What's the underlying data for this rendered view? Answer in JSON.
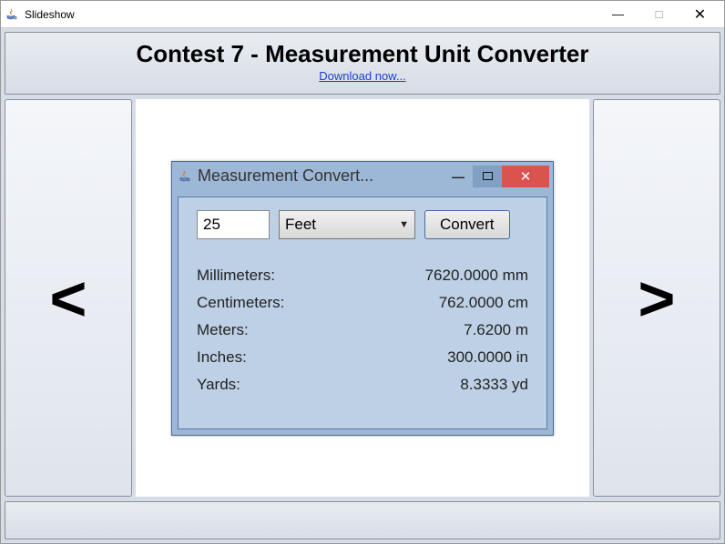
{
  "outer_window": {
    "title": "Slideshow",
    "minimize": "—",
    "maximize": "□",
    "close": "✕"
  },
  "header": {
    "title": "Contest 7 - Measurement Unit Converter",
    "link": "Download now..."
  },
  "nav": {
    "prev": "<",
    "next": ">"
  },
  "inner_window": {
    "title": "Measurement Convert...",
    "close": "✕",
    "controls": {
      "value": "25",
      "unit_selected": "Feet",
      "button": "Convert"
    },
    "results": [
      {
        "label": "Millimeters:",
        "value": "7620.0000 mm"
      },
      {
        "label": "Centimeters:",
        "value": "762.0000 cm"
      },
      {
        "label": "Meters:",
        "value": "7.6200 m"
      },
      {
        "label": "Inches:",
        "value": "300.0000 in"
      },
      {
        "label": "Yards:",
        "value": "8.3333 yd"
      }
    ]
  }
}
